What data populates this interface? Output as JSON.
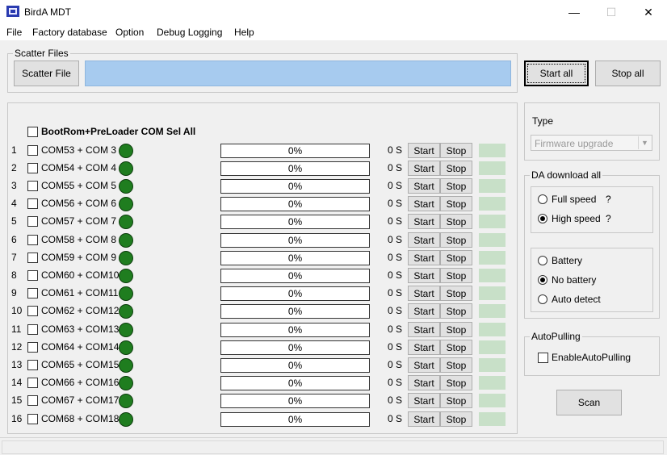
{
  "window": {
    "title": "BirdA MDT",
    "minimize": "—",
    "maximize": "☐",
    "close": "✕"
  },
  "menu": [
    "File",
    "Factory database",
    "Option",
    "Debug Logging",
    "Help"
  ],
  "scatter": {
    "group_title": "Scatter Files",
    "button": "Scatter File",
    "path": ""
  },
  "actions": {
    "start_all": "Start all",
    "stop_all": "Stop all",
    "scan": "Scan"
  },
  "ports": {
    "select_all": "BootRom+PreLoader COM Sel All",
    "rows": [
      {
        "index": "1",
        "com": "COM53 + COM 3",
        "progress": "0%",
        "time": "0 S",
        "start": "Start",
        "stop": "Stop"
      },
      {
        "index": "2",
        "com": "COM54 + COM 4",
        "progress": "0%",
        "time": "0 S",
        "start": "Start",
        "stop": "Stop"
      },
      {
        "index": "3",
        "com": "COM55 + COM 5",
        "progress": "0%",
        "time": "0 S",
        "start": "Start",
        "stop": "Stop"
      },
      {
        "index": "4",
        "com": "COM56 + COM 6",
        "progress": "0%",
        "time": "0 S",
        "start": "Start",
        "stop": "Stop"
      },
      {
        "index": "5",
        "com": "COM57 + COM 7",
        "progress": "0%",
        "time": "0 S",
        "start": "Start",
        "stop": "Stop"
      },
      {
        "index": "6",
        "com": "COM58 + COM 8",
        "progress": "0%",
        "time": "0 S",
        "start": "Start",
        "stop": "Stop"
      },
      {
        "index": "7",
        "com": "COM59 + COM 9",
        "progress": "0%",
        "time": "0 S",
        "start": "Start",
        "stop": "Stop"
      },
      {
        "index": "8",
        "com": "COM60 + COM10",
        "progress": "0%",
        "time": "0 S",
        "start": "Start",
        "stop": "Stop"
      },
      {
        "index": "9",
        "com": "COM61 + COM11",
        "progress": "0%",
        "time": "0 S",
        "start": "Start",
        "stop": "Stop"
      },
      {
        "index": "10",
        "com": "COM62 + COM12",
        "progress": "0%",
        "time": "0 S",
        "start": "Start",
        "stop": "Stop"
      },
      {
        "index": "11",
        "com": "COM63 + COM13",
        "progress": "0%",
        "time": "0 S",
        "start": "Start",
        "stop": "Stop"
      },
      {
        "index": "12",
        "com": "COM64 + COM14",
        "progress": "0%",
        "time": "0 S",
        "start": "Start",
        "stop": "Stop"
      },
      {
        "index": "13",
        "com": "COM65 + COM15",
        "progress": "0%",
        "time": "0 S",
        "start": "Start",
        "stop": "Stop"
      },
      {
        "index": "14",
        "com": "COM66 + COM16",
        "progress": "0%",
        "time": "0 S",
        "start": "Start",
        "stop": "Stop"
      },
      {
        "index": "15",
        "com": "COM67 + COM17",
        "progress": "0%",
        "time": "0 S",
        "start": "Start",
        "stop": "Stop"
      },
      {
        "index": "16",
        "com": "COM68 + COM18",
        "progress": "0%",
        "time": "0 S",
        "start": "Start",
        "stop": "Stop"
      }
    ]
  },
  "type_panel": {
    "label": "Type",
    "selected": "Firmware upgrade"
  },
  "da_download": {
    "title": "DA download all",
    "speed": [
      {
        "label": "Full speed",
        "hint": "?",
        "checked": false
      },
      {
        "label": "High speed",
        "hint": "?",
        "checked": true
      }
    ],
    "battery": [
      {
        "label": "Battery",
        "checked": false
      },
      {
        "label": "No battery",
        "checked": true
      },
      {
        "label": "Auto detect",
        "checked": false
      }
    ]
  },
  "autopulling": {
    "title": "AutoPulling",
    "checkbox_label": "EnableAutoPulling"
  },
  "colors": {
    "path_field": "#a7cbef",
    "led": "#1f7d1f",
    "status_cell": "#c8e0c8"
  },
  "icons": {
    "app": "chip-icon",
    "combo": "chevron-down-icon"
  }
}
